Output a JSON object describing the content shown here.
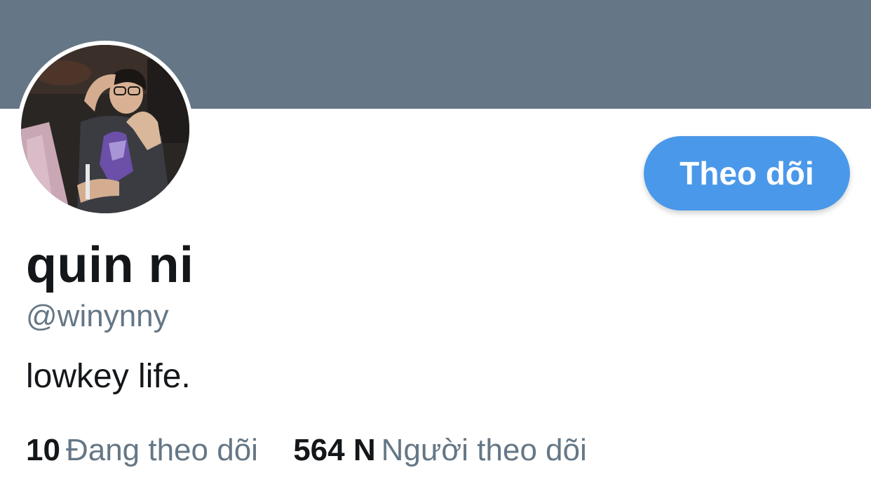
{
  "profile": {
    "display_name": "quin ni",
    "handle": "@winynny",
    "bio": "lowkey life.",
    "follow_label": "Theo dõi"
  },
  "stats": {
    "following_count": "10",
    "following_label": "Đang theo dõi",
    "followers_count": "564 N",
    "followers_label": "Người theo dõi"
  },
  "colors": {
    "banner": "#657786",
    "accent": "#4a98e9",
    "text_primary": "#14171a",
    "text_secondary": "#657786"
  }
}
